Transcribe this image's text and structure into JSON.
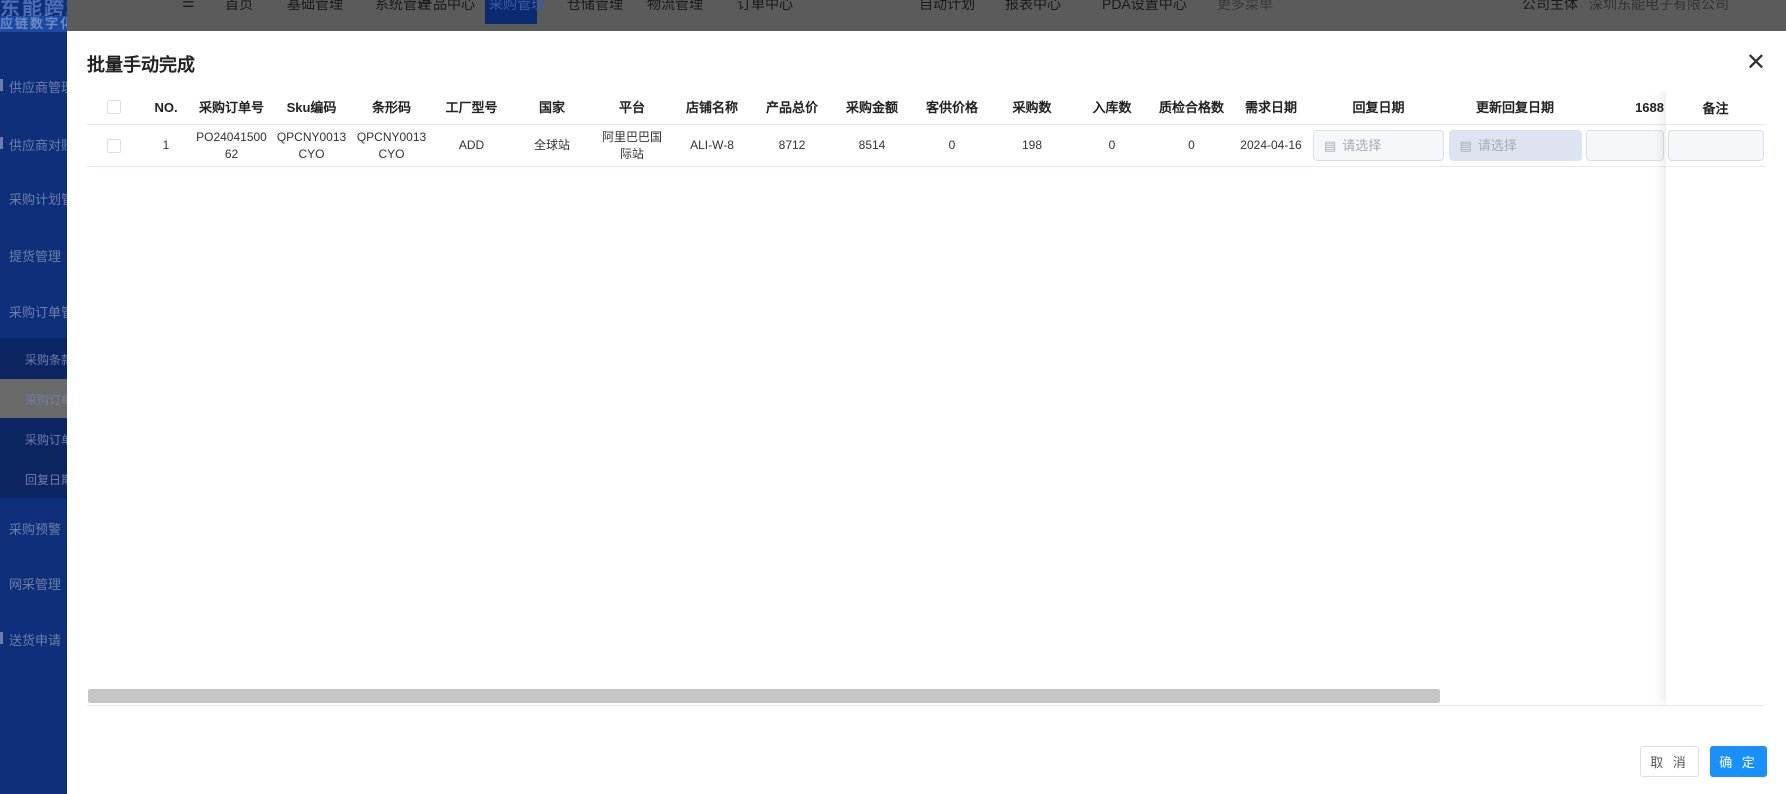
{
  "logo": {
    "line1": "东能跨境电商",
    "line2": "应链数字化管理平台"
  },
  "topnav": {
    "items": [
      "首页",
      "基础管理",
      "系统管理",
      "产品中心",
      "采购管理",
      "仓储管理",
      "物流管理",
      "订单中心",
      "自动计划",
      "报表中心",
      "PDA设置中心",
      "更多菜单"
    ],
    "active": "采购管理",
    "company_label": "公司主体",
    "company_value": "深圳东能电子有限公司"
  },
  "sidebar": {
    "items": [
      "供应商管理",
      "供应商对账",
      "采购计划管理",
      "提货管理",
      "采购订单管理"
    ],
    "subitems": [
      "采购条款",
      "采购订单",
      "采购订单",
      "回复日期"
    ],
    "items2": [
      "采购预警",
      "网采管理",
      "送货申请"
    ]
  },
  "dialog": {
    "title": "批量手动完成",
    "cancel": "取 消",
    "ok": "确 定"
  },
  "table": {
    "headers": [
      "NO.",
      "采购订单号",
      "Sku编码",
      "条形码",
      "工厂型号",
      "国家",
      "平台",
      "店铺名称",
      "产品总价",
      "采购金额",
      "客供价格",
      "采购数",
      "入库数",
      "质检合格数",
      "需求日期",
      "回复日期",
      "更新回复日期",
      "1688",
      "备注"
    ],
    "rows": [
      {
        "no": "1",
        "order": "PO2404150062",
        "sku": "QPCNY0013CYO",
        "barcode": "QPCNY0013CYO",
        "factory": "ADD",
        "country": "全球站",
        "platform": "阿里巴巴国际站",
        "shop": "ALI-W-8",
        "total": "8712",
        "amount": "8514",
        "cust_price": "0",
        "qty": "198",
        "in_qty": "0",
        "qc_qty": "0",
        "need_date": "2024-04-16",
        "reply_placeholder": "请选择",
        "update_placeholder": "请选择"
      }
    ]
  },
  "colors": {
    "primary": "#1890ff",
    "sidebar": "#0f2f7a"
  }
}
